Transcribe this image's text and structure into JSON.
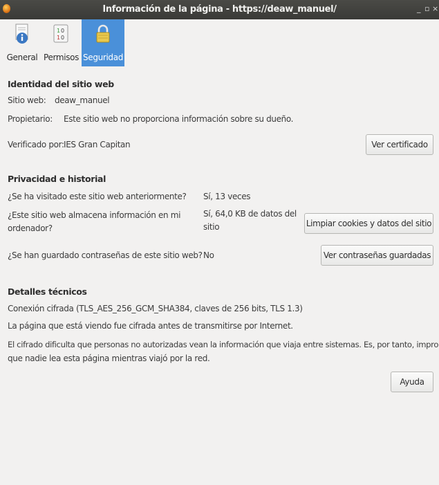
{
  "window": {
    "title": "Información de la página - https://deaw_manuel/",
    "minimize": "_",
    "maximize": "▫",
    "close": "×"
  },
  "tabs": [
    {
      "label": "General",
      "icon": "info-icon",
      "selected": false
    },
    {
      "label": "Permisos",
      "icon": "permissions-icon",
      "selected": false
    },
    {
      "label": "Seguridad",
      "icon": "lock-icon",
      "selected": true
    }
  ],
  "identity": {
    "heading": "Identidad del sitio web",
    "website_label": "Sitio web:",
    "website_value": "deaw_manuel",
    "owner_label": "Propietario:",
    "owner_value": "Este sitio web no proporciona información sobre su dueño.",
    "verified_label": "Verificado por:",
    "verified_value": "IES Gran Capitan",
    "view_certificate_button": "Ver certificado"
  },
  "privacy": {
    "heading": "Privacidad e historial",
    "visited_question": "¿Se ha visitado este sitio web anteriormente?",
    "visited_answer": "Sí, 13 veces",
    "stores_question_line1": "¿Este sitio web almacena información en mi",
    "stores_question_line2": "ordenador?",
    "stores_answer_line1": "Sí, 64,0 KB de datos del",
    "stores_answer_line2": "sitio",
    "clear_cookies_button": "Limpiar cookies y datos del sitio",
    "passwords_question": "¿Se han guardado contraseñas de este sitio web?",
    "passwords_answer": "No",
    "view_passwords_button": "Ver contraseñas guardadas"
  },
  "technical": {
    "heading": "Detalles técnicos",
    "connection": "Conexión cifrada (TLS_AES_256_GCM_SHA384, claves de 256 bits, TLS 1.3)",
    "line2": "La página que está viendo fue cifrada antes de transmitirse por Internet.",
    "line3a": "El cifrado dificulta que personas no autorizadas vean la información que viaja entre sistemas. Es, por tanto, improbable",
    "line3b": "que nadie lea esta página mientras viajó por la red."
  },
  "help_button": "Ayuda",
  "colors": {
    "titlebar": "#3f3f3c",
    "selected_tab": "#4a90d9",
    "background": "#f2f1f0"
  }
}
